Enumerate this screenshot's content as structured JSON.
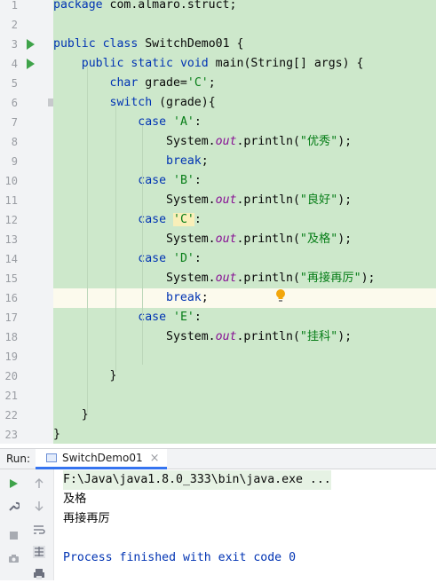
{
  "editor": {
    "lines": [
      {
        "n": "1",
        "tokens": [
          [
            "kw",
            "package"
          ],
          [
            "",
            "&nbsp;com.almaro.struct;"
          ]
        ]
      },
      {
        "n": "2",
        "tokens": []
      },
      {
        "n": "3",
        "run": true,
        "tokens": [
          [
            "kw",
            "public"
          ],
          [
            "",
            "&nbsp;"
          ],
          [
            "kw",
            "class"
          ],
          [
            "",
            "&nbsp;SwitchDemo01&nbsp;{"
          ]
        ]
      },
      {
        "n": "4",
        "run": true,
        "tokens": [
          [
            "",
            "&nbsp;&nbsp;&nbsp;&nbsp;"
          ],
          [
            "kw",
            "public"
          ],
          [
            "",
            "&nbsp;"
          ],
          [
            "kw",
            "static"
          ],
          [
            "",
            "&nbsp;"
          ],
          [
            "kw",
            "void"
          ],
          [
            "",
            "&nbsp;"
          ],
          [
            "fn",
            "main"
          ],
          [
            "",
            "(String[]&nbsp;args)&nbsp;{"
          ]
        ]
      },
      {
        "n": "5",
        "tokens": [
          [
            "",
            "&nbsp;&nbsp;&nbsp;&nbsp;&nbsp;&nbsp;&nbsp;&nbsp;"
          ],
          [
            "kw",
            "char"
          ],
          [
            "",
            "&nbsp;grade="
          ],
          [
            "str",
            "'C'"
          ],
          [
            "",
            ";"
          ]
        ]
      },
      {
        "n": "6",
        "fold": true,
        "tokens": [
          [
            "",
            "&nbsp;&nbsp;&nbsp;&nbsp;&nbsp;&nbsp;&nbsp;&nbsp;"
          ],
          [
            "kw",
            "switch"
          ],
          [
            "",
            "&nbsp;(grade){"
          ]
        ]
      },
      {
        "n": "7",
        "tokens": [
          [
            "",
            "&nbsp;&nbsp;&nbsp;&nbsp;&nbsp;&nbsp;&nbsp;&nbsp;&nbsp;&nbsp;&nbsp;&nbsp;"
          ],
          [
            "kw",
            "case"
          ],
          [
            "",
            "&nbsp;"
          ],
          [
            "str",
            "'A'"
          ],
          [
            "",
            ":"
          ]
        ]
      },
      {
        "n": "8",
        "tokens": [
          [
            "",
            "&nbsp;&nbsp;&nbsp;&nbsp;&nbsp;&nbsp;&nbsp;&nbsp;&nbsp;&nbsp;&nbsp;&nbsp;&nbsp;&nbsp;&nbsp;&nbsp;System."
          ],
          [
            "fld",
            "out"
          ],
          [
            "",
            ".println("
          ],
          [
            "str",
            "\"优秀\""
          ],
          [
            "",
            ");"
          ]
        ]
      },
      {
        "n": "9",
        "tokens": [
          [
            "",
            "&nbsp;&nbsp;&nbsp;&nbsp;&nbsp;&nbsp;&nbsp;&nbsp;&nbsp;&nbsp;&nbsp;&nbsp;&nbsp;&nbsp;&nbsp;&nbsp;"
          ],
          [
            "kw",
            "break"
          ],
          [
            "",
            ";"
          ]
        ]
      },
      {
        "n": "10",
        "tokens": [
          [
            "",
            "&nbsp;&nbsp;&nbsp;&nbsp;&nbsp;&nbsp;&nbsp;&nbsp;&nbsp;&nbsp;&nbsp;&nbsp;"
          ],
          [
            "kw",
            "case"
          ],
          [
            "",
            "&nbsp;"
          ],
          [
            "str",
            "'B'"
          ],
          [
            "",
            ":"
          ]
        ]
      },
      {
        "n": "11",
        "tokens": [
          [
            "",
            "&nbsp;&nbsp;&nbsp;&nbsp;&nbsp;&nbsp;&nbsp;&nbsp;&nbsp;&nbsp;&nbsp;&nbsp;&nbsp;&nbsp;&nbsp;&nbsp;System."
          ],
          [
            "fld",
            "out"
          ],
          [
            "",
            ".println("
          ],
          [
            "str",
            "\"良好\""
          ],
          [
            "",
            ");"
          ]
        ]
      },
      {
        "n": "12",
        "tokens": [
          [
            "",
            "&nbsp;&nbsp;&nbsp;&nbsp;&nbsp;&nbsp;&nbsp;&nbsp;&nbsp;&nbsp;&nbsp;&nbsp;"
          ],
          [
            "kw",
            "case"
          ],
          [
            "",
            "&nbsp;"
          ],
          [
            "hlstr",
            "'C'"
          ],
          [
            "",
            ":"
          ]
        ]
      },
      {
        "n": "13",
        "tokens": [
          [
            "",
            "&nbsp;&nbsp;&nbsp;&nbsp;&nbsp;&nbsp;&nbsp;&nbsp;&nbsp;&nbsp;&nbsp;&nbsp;&nbsp;&nbsp;&nbsp;&nbsp;System."
          ],
          [
            "fld",
            "out"
          ],
          [
            "",
            ".println("
          ],
          [
            "str",
            "\"及格\""
          ],
          [
            "",
            ");"
          ]
        ]
      },
      {
        "n": "14",
        "tokens": [
          [
            "",
            "&nbsp;&nbsp;&nbsp;&nbsp;&nbsp;&nbsp;&nbsp;&nbsp;&nbsp;&nbsp;&nbsp;&nbsp;"
          ],
          [
            "kw",
            "case"
          ],
          [
            "",
            "&nbsp;"
          ],
          [
            "str",
            "'D'"
          ],
          [
            "",
            ":"
          ]
        ]
      },
      {
        "n": "15",
        "tokens": [
          [
            "",
            "&nbsp;&nbsp;&nbsp;&nbsp;&nbsp;&nbsp;&nbsp;&nbsp;&nbsp;&nbsp;&nbsp;&nbsp;&nbsp;&nbsp;&nbsp;&nbsp;System."
          ],
          [
            "fld",
            "out"
          ],
          [
            "",
            ".println("
          ],
          [
            "str",
            "\"再接再厉\""
          ],
          [
            "",
            ");"
          ]
        ]
      },
      {
        "n": "16",
        "current": true,
        "tokens": [
          [
            "",
            "&nbsp;&nbsp;&nbsp;&nbsp;&nbsp;&nbsp;&nbsp;&nbsp;&nbsp;&nbsp;&nbsp;&nbsp;&nbsp;&nbsp;&nbsp;&nbsp;"
          ],
          [
            "kw",
            "break"
          ],
          [
            "",
            ";"
          ]
        ]
      },
      {
        "n": "17",
        "tokens": [
          [
            "",
            "&nbsp;&nbsp;&nbsp;&nbsp;&nbsp;&nbsp;&nbsp;&nbsp;&nbsp;&nbsp;&nbsp;&nbsp;"
          ],
          [
            "kw",
            "case"
          ],
          [
            "",
            "&nbsp;"
          ],
          [
            "str",
            "'E'"
          ],
          [
            "",
            ":"
          ]
        ]
      },
      {
        "n": "18",
        "tokens": [
          [
            "",
            "&nbsp;&nbsp;&nbsp;&nbsp;&nbsp;&nbsp;&nbsp;&nbsp;&nbsp;&nbsp;&nbsp;&nbsp;&nbsp;&nbsp;&nbsp;&nbsp;System."
          ],
          [
            "fld",
            "out"
          ],
          [
            "",
            ".println("
          ],
          [
            "str",
            "\"挂科\""
          ],
          [
            "",
            ");"
          ]
        ]
      },
      {
        "n": "19",
        "tokens": []
      },
      {
        "n": "20",
        "tokens": [
          [
            "",
            "&nbsp;&nbsp;&nbsp;&nbsp;&nbsp;&nbsp;&nbsp;&nbsp;}"
          ]
        ]
      },
      {
        "n": "21",
        "tokens": []
      },
      {
        "n": "22",
        "tokens": [
          [
            "",
            "&nbsp;&nbsp;&nbsp;&nbsp;}"
          ]
        ]
      },
      {
        "n": "23",
        "tokens": [
          [
            "",
            "}"
          ]
        ]
      }
    ]
  },
  "run_window": {
    "label": "Run:",
    "tab_title": "SwitchDemo01",
    "tab_close": "×"
  },
  "console": {
    "command": "F:\\Java\\java1.8.0_333\\bin\\java.exe ...",
    "output_1": "及格",
    "output_2": "再接再厉",
    "exit_message": "Process finished with exit code 0"
  },
  "icons": {
    "toolbar": [
      "rerun-icon",
      "up-arrow-icon",
      "wrench-icon",
      "down-arrow-icon",
      "soft-wrap-icon",
      "stop-icon",
      "scroll-to-end-icon",
      "camera-icon",
      "print-icon"
    ]
  },
  "colors": {
    "code_background": "#cde8cb",
    "current_line": "#fcfaed",
    "keyword": "#0033b3",
    "string": "#067d17",
    "field": "#871094",
    "run_icon": "#3fa34a",
    "tab_underline": "#3574f0"
  }
}
